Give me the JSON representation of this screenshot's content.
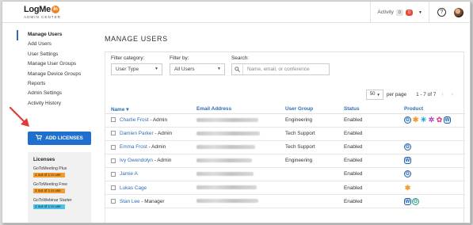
{
  "header": {
    "logo_main": "LogMe",
    "logo_in": "In",
    "logo_sub": "ADMIN CENTER",
    "activity_label": "Activity",
    "activity_count_1": "0",
    "activity_count_2": "0",
    "help_label": "?"
  },
  "sidebar": {
    "items": [
      {
        "label": "Manage Users"
      },
      {
        "label": "Add Users"
      },
      {
        "label": "User Settings"
      },
      {
        "label": "Manage User Groups"
      },
      {
        "label": "Manage Device Groups"
      },
      {
        "label": "Reports"
      },
      {
        "label": "Admin Settings"
      },
      {
        "label": "Activity History"
      }
    ],
    "add_licenses_label": "ADD LICENSES",
    "licenses": {
      "title": "Licenses",
      "items": [
        {
          "name": "GoToMeeting Plus",
          "usage": "1 out of 1 in use",
          "color": "#f39c2b"
        },
        {
          "name": "GoToMeeting Free",
          "usage": "1 out of 1 in use",
          "color": "#f39c2b"
        },
        {
          "name": "GoToWebinar Starter",
          "usage": "1 out of 1 in use",
          "color": "#4bc1e8"
        }
      ]
    }
  },
  "main": {
    "page_title": "MANAGE USERS",
    "filters": {
      "category_label": "Filter category:",
      "category_value": "User Type",
      "filterby_label": "Filter by:",
      "filterby_value": "All Users",
      "search_label": "Search:",
      "search_placeholder": "Name, email, or conference"
    },
    "pager": {
      "per_page_value": "50",
      "per_page_label": "per page",
      "range": "1 - 7 of 7"
    },
    "table": {
      "columns": [
        "Name",
        "Email Address",
        "User Group",
        "Status",
        "Product"
      ],
      "sort_indicator": "▾",
      "rows": [
        {
          "name": "Charlie Frost",
          "role": " - Admin",
          "group": "Engineering",
          "status": "Enabled",
          "products": [
            "g2m-icon",
            "star-icon",
            "snowflake-icon",
            "flower-icon",
            "flower-pink-icon",
            "g2w-icon"
          ]
        },
        {
          "name": "Damien Parker",
          "role": " - Admin",
          "group": "Tech Support",
          "status": "Enabled",
          "products": []
        },
        {
          "name": "Emma Frost",
          "role": " - Admin",
          "group": "Tech Support",
          "status": "Enabled",
          "products": [
            "g2m-icon"
          ]
        },
        {
          "name": "Ivy Gwendolyn",
          "role": " - Admin",
          "group": "Engineering",
          "status": "Enabled",
          "products": [
            "g2w-icon"
          ]
        },
        {
          "name": "Jamie A",
          "role": "",
          "group": "",
          "status": "Enabled",
          "products": [
            "g2m-icon"
          ]
        },
        {
          "name": "Lukas Cage",
          "role": "",
          "group": "",
          "status": "Enabled",
          "products": [
            "star-icon"
          ]
        },
        {
          "name": "Stan Lee",
          "role": " - Manager",
          "group": "",
          "status": "Enabled",
          "products": [
            "g2w-icon",
            "g2t-icon"
          ]
        }
      ]
    }
  }
}
